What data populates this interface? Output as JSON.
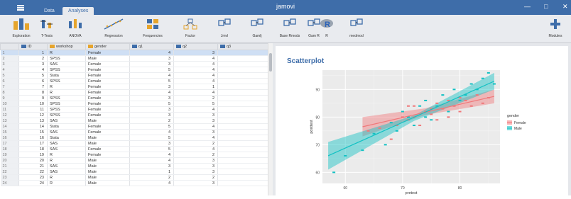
{
  "app": {
    "title": "jamovi",
    "tabs": [
      {
        "label": "Data"
      },
      {
        "label": "Analyses"
      }
    ],
    "window_controls": [
      "—",
      "□",
      "✕"
    ]
  },
  "toolbar": {
    "items": [
      {
        "label": "Exploration",
        "icon": "bar-chart-icon"
      },
      {
        "label": "T-Tests",
        "icon": "ttest-icon"
      },
      {
        "label": "ANOVA",
        "icon": "anova-icon"
      },
      {
        "label": "Regression",
        "icon": "regression-icon"
      },
      {
        "label": "Frequencies",
        "icon": "frequencies-icon"
      },
      {
        "label": "Factor",
        "icon": "factor-icon"
      },
      {
        "label": "Jmvl",
        "icon": "module-icon"
      },
      {
        "label": "Gamlj",
        "icon": "module-icon"
      },
      {
        "label": "Base Rmods",
        "icon": "module-icon"
      },
      {
        "label": "Gam R",
        "icon": "module-icon"
      },
      {
        "label": "R",
        "icon": "r-icon"
      },
      {
        "label": "medmod",
        "icon": "module-icon"
      }
    ],
    "modules_label": "Modules"
  },
  "grid": {
    "columns": [
      "ID",
      "workshop",
      "gender",
      "q1",
      "q2",
      "q3"
    ],
    "rows": [
      [
        "1",
        "1",
        "R",
        "Female",
        "4",
        "3"
      ],
      [
        "2",
        "2",
        "SPSS",
        "Male",
        "3",
        "4"
      ],
      [
        "3",
        "3",
        "SAS",
        "Female",
        "3",
        "4"
      ],
      [
        "4",
        "4",
        "SPSS",
        "Female",
        "5",
        "4"
      ],
      [
        "5",
        "5",
        "Stata",
        "Female",
        "4",
        "4"
      ],
      [
        "6",
        "6",
        "SPSS",
        "Female",
        "5",
        "4"
      ],
      [
        "7",
        "7",
        "R",
        "Female",
        "3",
        "1"
      ],
      [
        "8",
        "8",
        "R",
        "Female",
        "4",
        "4"
      ],
      [
        "9",
        "9",
        "SPSS",
        "Female",
        "3",
        "2"
      ],
      [
        "10",
        "10",
        "SPSS",
        "Female",
        "5",
        "5"
      ],
      [
        "11",
        "11",
        "SPSS",
        "Female",
        "3",
        "4"
      ],
      [
        "12",
        "12",
        "SPSS",
        "Female",
        "3",
        "3"
      ],
      [
        "13",
        "13",
        "SAS",
        "Male",
        "2",
        "3"
      ],
      [
        "14",
        "14",
        "Stata",
        "Female",
        "5",
        "4"
      ],
      [
        "15",
        "15",
        "SAS",
        "Female",
        "4",
        "3"
      ],
      [
        "16",
        "16",
        "Stata",
        "Male",
        "5",
        "4"
      ],
      [
        "17",
        "17",
        "SAS",
        "Male",
        "3",
        "2"
      ],
      [
        "18",
        "18",
        "SAS",
        "Female",
        "5",
        "4"
      ],
      [
        "19",
        "19",
        "R",
        "Female",
        "4",
        "2"
      ],
      [
        "20",
        "20",
        "R",
        "Male",
        "4",
        "3"
      ],
      [
        "21",
        "21",
        "SAS",
        "Male",
        "3",
        "3"
      ],
      [
        "22",
        "22",
        "SAS",
        "Male",
        "1",
        "3"
      ],
      [
        "23",
        "23",
        "R",
        "Male",
        "2",
        "2"
      ],
      [
        "24",
        "24",
        "R",
        "Male",
        "4",
        "3"
      ]
    ]
  },
  "results": {
    "heading": "Scatterplot",
    "chart_data": {
      "type": "scatter",
      "xlabel": "pretest",
      "ylabel": "posttest",
      "x_ticks": [
        "60",
        "70",
        "80"
      ],
      "y_ticks": [
        "60",
        "70",
        "80",
        "90"
      ],
      "xlim": [
        56,
        87
      ],
      "ylim": [
        56,
        97
      ],
      "legend_title": "gender",
      "legend_position": "right",
      "grid": true,
      "series": [
        {
          "name": "Female",
          "color": "#f0787a",
          "points": [
            [
              64,
              75
            ],
            [
              66,
              76
            ],
            [
              68,
              72
            ],
            [
              69,
              77
            ],
            [
              70,
              80
            ],
            [
              71,
              84
            ],
            [
              71,
              79
            ],
            [
              72,
              84
            ],
            [
              72,
              80
            ],
            [
              73,
              77
            ],
            [
              74,
              82
            ],
            [
              75,
              83
            ],
            [
              75,
              81
            ],
            [
              76,
              85
            ],
            [
              76,
              79
            ],
            [
              77,
              83
            ],
            [
              78,
              80
            ],
            [
              78,
              86
            ],
            [
              79,
              84
            ],
            [
              80,
              82
            ],
            [
              80,
              87
            ],
            [
              81,
              86
            ],
            [
              82,
              84
            ],
            [
              83,
              88
            ],
            [
              84,
              85
            ],
            [
              85,
              87
            ]
          ],
          "fit_line": [
            [
              63,
              76.5
            ],
            [
              86,
              87.5
            ]
          ],
          "ci_upper": [
            [
              63,
              80
            ],
            [
              74,
              83.2
            ],
            [
              86,
              90
            ]
          ],
          "ci_lower": [
            [
              63,
              73
            ],
            [
              74,
              80.8
            ],
            [
              86,
              85
            ]
          ]
        },
        {
          "name": "Male",
          "color": "#12c1c3",
          "points": [
            [
              58,
              60
            ],
            [
              60,
              66
            ],
            [
              63,
              68
            ],
            [
              65,
              74
            ],
            [
              67,
              70
            ],
            [
              68,
              78
            ],
            [
              69,
              75
            ],
            [
              70,
              82
            ],
            [
              71,
              80
            ],
            [
              72,
              77
            ],
            [
              73,
              84
            ],
            [
              74,
              80
            ],
            [
              74,
              86
            ],
            [
              75,
              79
            ],
            [
              76,
              84
            ],
            [
              77,
              88
            ],
            [
              78,
              82
            ],
            [
              79,
              90
            ],
            [
              80,
              86
            ],
            [
              81,
              88
            ],
            [
              82,
              92
            ],
            [
              83,
              90
            ],
            [
              84,
              94
            ],
            [
              85,
              96
            ],
            [
              86,
              92
            ]
          ],
          "fit_line": [
            [
              57,
              66
            ],
            [
              86,
              93
            ]
          ],
          "ci_upper": [
            [
              57,
              71
            ],
            [
              72,
              80.6
            ],
            [
              86,
              96
            ]
          ],
          "ci_lower": [
            [
              57,
              61
            ],
            [
              72,
              78.6
            ],
            [
              86,
              90
            ]
          ]
        }
      ]
    }
  }
}
